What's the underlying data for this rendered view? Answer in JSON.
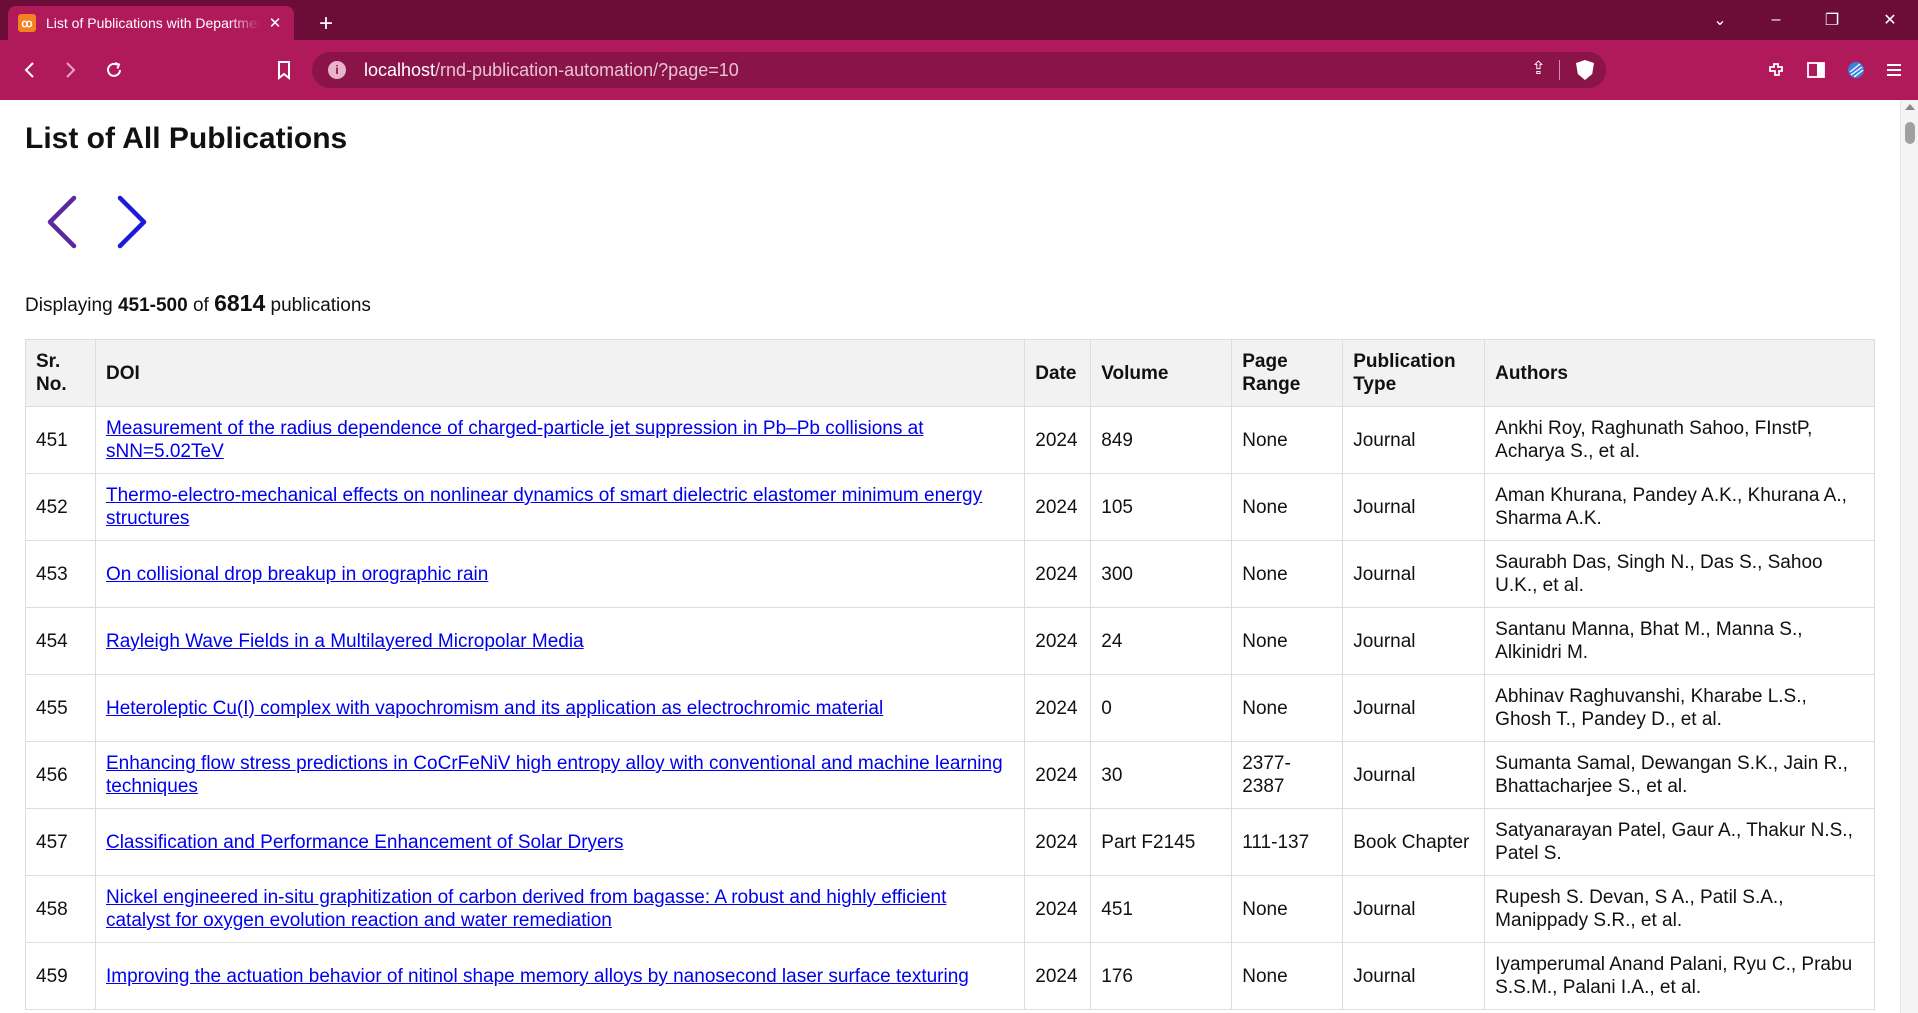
{
  "browser": {
    "tab_title": "List of Publications with Department",
    "url_host": "localhost",
    "url_path": "/rnd-publication-automation/?page=10"
  },
  "page": {
    "title": "List of All Publications",
    "summary": {
      "prefix": "Displaying",
      "range": "451-500",
      "of": "of",
      "total": "6814",
      "suffix": "publications"
    }
  },
  "table": {
    "headers": {
      "sr": "Sr. No.",
      "doi": "DOI",
      "date": "Date",
      "volume": "Volume",
      "page_range": "Page Range",
      "type": "Publication Type",
      "authors": "Authors"
    },
    "rows": [
      {
        "sr": "451",
        "title": "Measurement of the radius dependence of charged-particle jet suppression in Pb–Pb collisions at sNN=5.02TeV",
        "date": "2024",
        "volume": "849",
        "page_range": "None",
        "type": "Journal",
        "authors": "Ankhi Roy, Raghunath Sahoo, FInstP, Acharya S., et al."
      },
      {
        "sr": "452",
        "title": "Thermo-electro-mechanical effects on nonlinear dynamics of smart dielectric elastomer minimum energy structures",
        "date": "2024",
        "volume": "105",
        "page_range": "None",
        "type": "Journal",
        "authors": "Aman Khurana, Pandey A.K., Khurana A., Sharma A.K."
      },
      {
        "sr": "453",
        "title": "On collisional drop breakup in orographic rain",
        "date": "2024",
        "volume": "300",
        "page_range": "None",
        "type": "Journal",
        "authors": "Saurabh Das, Singh N., Das S., Sahoo U.K., et al."
      },
      {
        "sr": "454",
        "title": "Rayleigh Wave Fields in a Multilayered Micropolar Media",
        "date": "2024",
        "volume": "24",
        "page_range": "None",
        "type": "Journal",
        "authors": "Santanu Manna, Bhat M., Manna S., Alkinidri M."
      },
      {
        "sr": "455",
        "title": "Heteroleptic Cu(I) complex with vapochromism and its application as electrochromic material",
        "date": "2024",
        "volume": "0",
        "page_range": "None",
        "type": "Journal",
        "authors": "Abhinav Raghuvanshi, Kharabe L.S., Ghosh T., Pandey D., et al."
      },
      {
        "sr": "456",
        "title": "Enhancing flow stress predictions in CoCrFeNiV high entropy alloy with conventional and machine learning techniques",
        "date": "2024",
        "volume": "30",
        "page_range": "2377-2387",
        "type": "Journal",
        "authors": "Sumanta Samal, Dewangan S.K., Jain R., Bhattacharjee S., et al."
      },
      {
        "sr": "457",
        "title": "Classification and Performance Enhancement of Solar Dryers",
        "date": "2024",
        "volume": "Part F2145",
        "page_range": "111-137",
        "type": "Book Chapter",
        "authors": "Satyanarayan Patel, Gaur A., Thakur N.S., Patel S."
      },
      {
        "sr": "458",
        "title": "Nickel engineered in-situ graphitization of carbon derived from bagasse: A robust and highly efficient catalyst for oxygen evolution reaction and water remediation",
        "date": "2024",
        "volume": "451",
        "page_range": "None",
        "type": "Journal",
        "authors": "Rupesh S. Devan, S A., Patil S.A., Manippady S.R., et al."
      },
      {
        "sr": "459",
        "title": "Improving the actuation behavior of nitinol shape memory alloys by nanosecond laser surface texturing",
        "date": "2024",
        "volume": "176",
        "page_range": "None",
        "type": "Journal",
        "authors": "Iyamperumal Anand Palani, Ryu C., Prabu S.S.M., Palani I.A., et al."
      }
    ]
  }
}
